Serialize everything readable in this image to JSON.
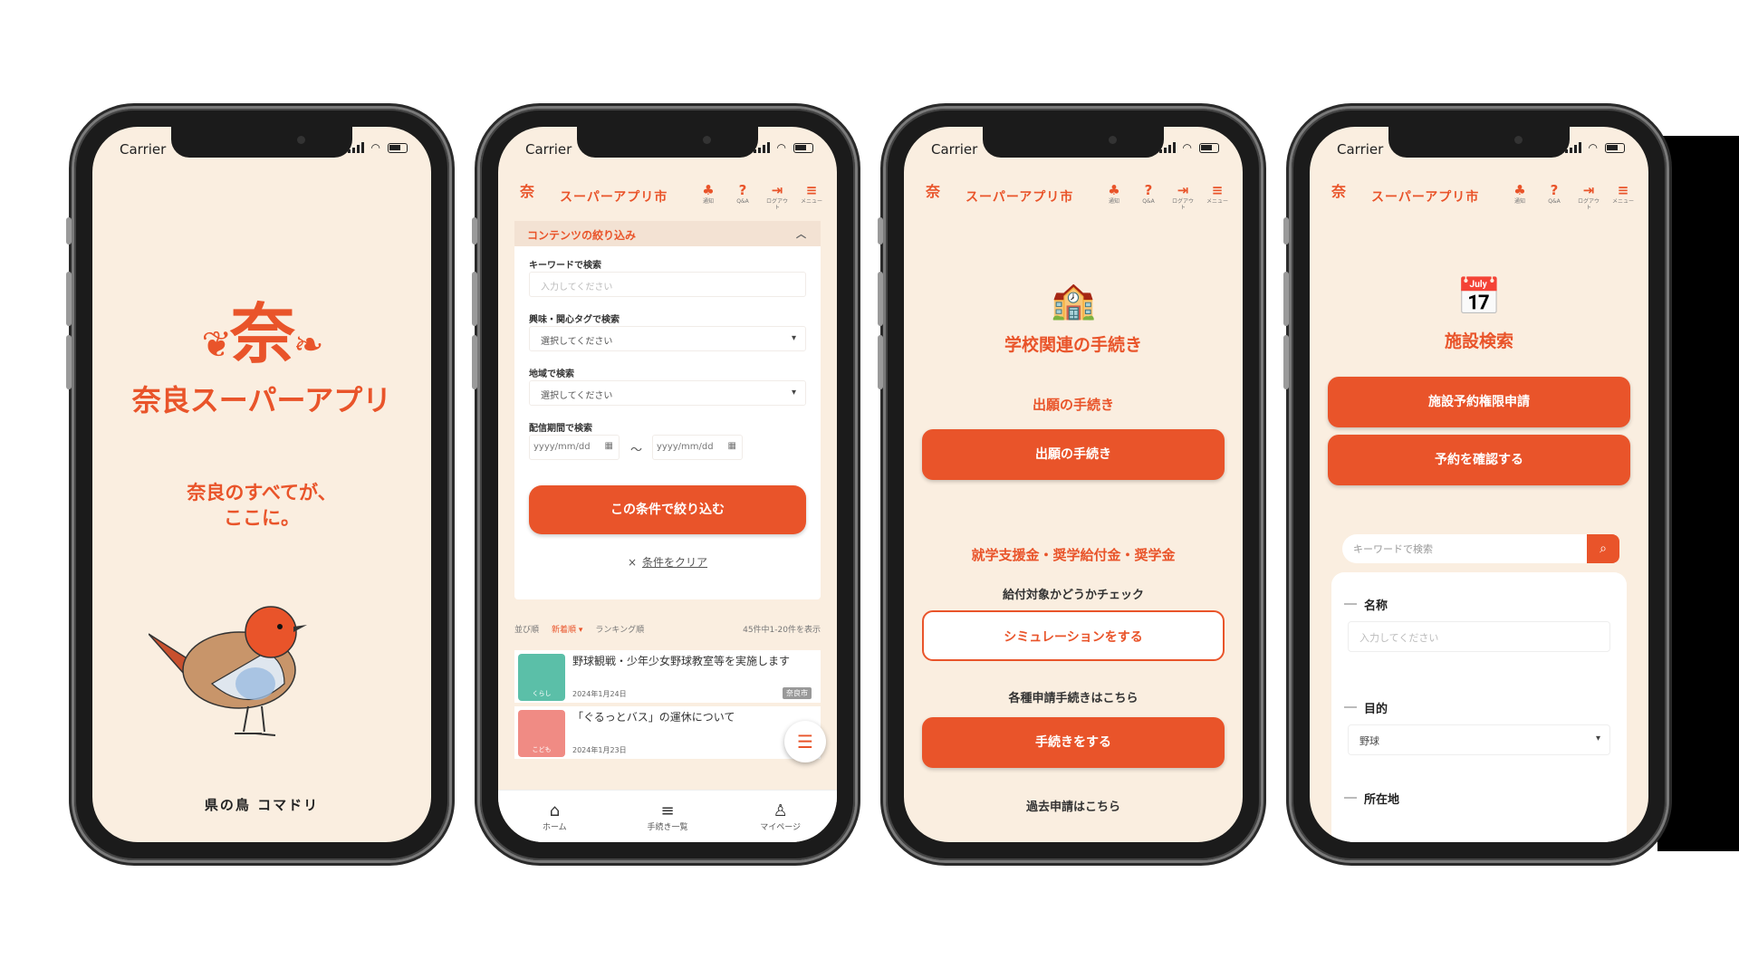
{
  "status": {
    "carrier": "Carrier"
  },
  "header": {
    "logo_kanji": "奈",
    "logo_caption": "奈良スーパーアプリ",
    "title": "スーパーアプリ市",
    "icons": [
      {
        "icon": "bell-icon",
        "label": "通知"
      },
      {
        "icon": "question-icon",
        "label": "Q&A"
      },
      {
        "icon": "logout-icon",
        "label": "ログアウト"
      },
      {
        "icon": "menu-icon",
        "label": "メニュー"
      }
    ]
  },
  "splash": {
    "logo_kanji": "奈",
    "app_name": "奈良スーパーアプリ",
    "tagline_line1": "奈良のすべてが、",
    "tagline_line2": "ここに。",
    "bird_caption": "県の鳥 コマドリ"
  },
  "filter": {
    "title": "コンテンツの絞り込み",
    "keyword_label": "キーワードで検索",
    "keyword_placeholder": "入力してください",
    "tag_label": "興味・関心タグで検索",
    "tag_value": "選択してください",
    "area_label": "地域で検索",
    "area_value": "選択してください",
    "period_label": "配信期間で検索",
    "date_placeholder": "yyyy/mm/dd",
    "tilde": "〜",
    "apply_button": "この条件で絞り込む",
    "clear_x": "×",
    "clear_label": "条件をクリア"
  },
  "sort": {
    "options": [
      "並び順",
      "新着順 ▾",
      "ランキング順"
    ],
    "count": "45件中1-20件を表示"
  },
  "news": [
    {
      "title": "野球観戦・少年少女野球教室等を実施します",
      "date": "2024年1月24日",
      "tag": "奈良市",
      "thumb_label": "くらし",
      "color": "#5bbfa8"
    },
    {
      "title": "「ぐるっとバス」の運休について",
      "date": "2024年1月23日",
      "tag": "",
      "thumb_label": "こども",
      "color": "#f08b84"
    }
  ],
  "tabbar": [
    {
      "icon": "home-icon",
      "label": "ホーム"
    },
    {
      "icon": "list-icon",
      "label": "手続き一覧"
    },
    {
      "icon": "person-icon",
      "label": "マイページ"
    }
  ],
  "school": {
    "title": "学校関連の手続き",
    "sub1": "出願の手続き",
    "btn1": "出願の手続き",
    "sub2": "就学支援金・奨学給付金・奨学金",
    "check_text": "給付対象かどうかチェック",
    "sim_button": "シミュレーションをする",
    "apply_text": "各種申請手続きはこちら",
    "apply_button": "手続きをする",
    "past_text": "過去申請はこちら"
  },
  "facility": {
    "title": "施設検索",
    "btn1": "施設予約権限申請",
    "btn2": "予約を確認する",
    "search_placeholder": "キーワードで検索",
    "name_label": "名称",
    "name_placeholder": "入力してください",
    "purpose_label": "目的",
    "purpose_value": "野球",
    "location_label": "所在地"
  },
  "colors": {
    "accent": "#e9542a",
    "background": "#faeee0"
  }
}
